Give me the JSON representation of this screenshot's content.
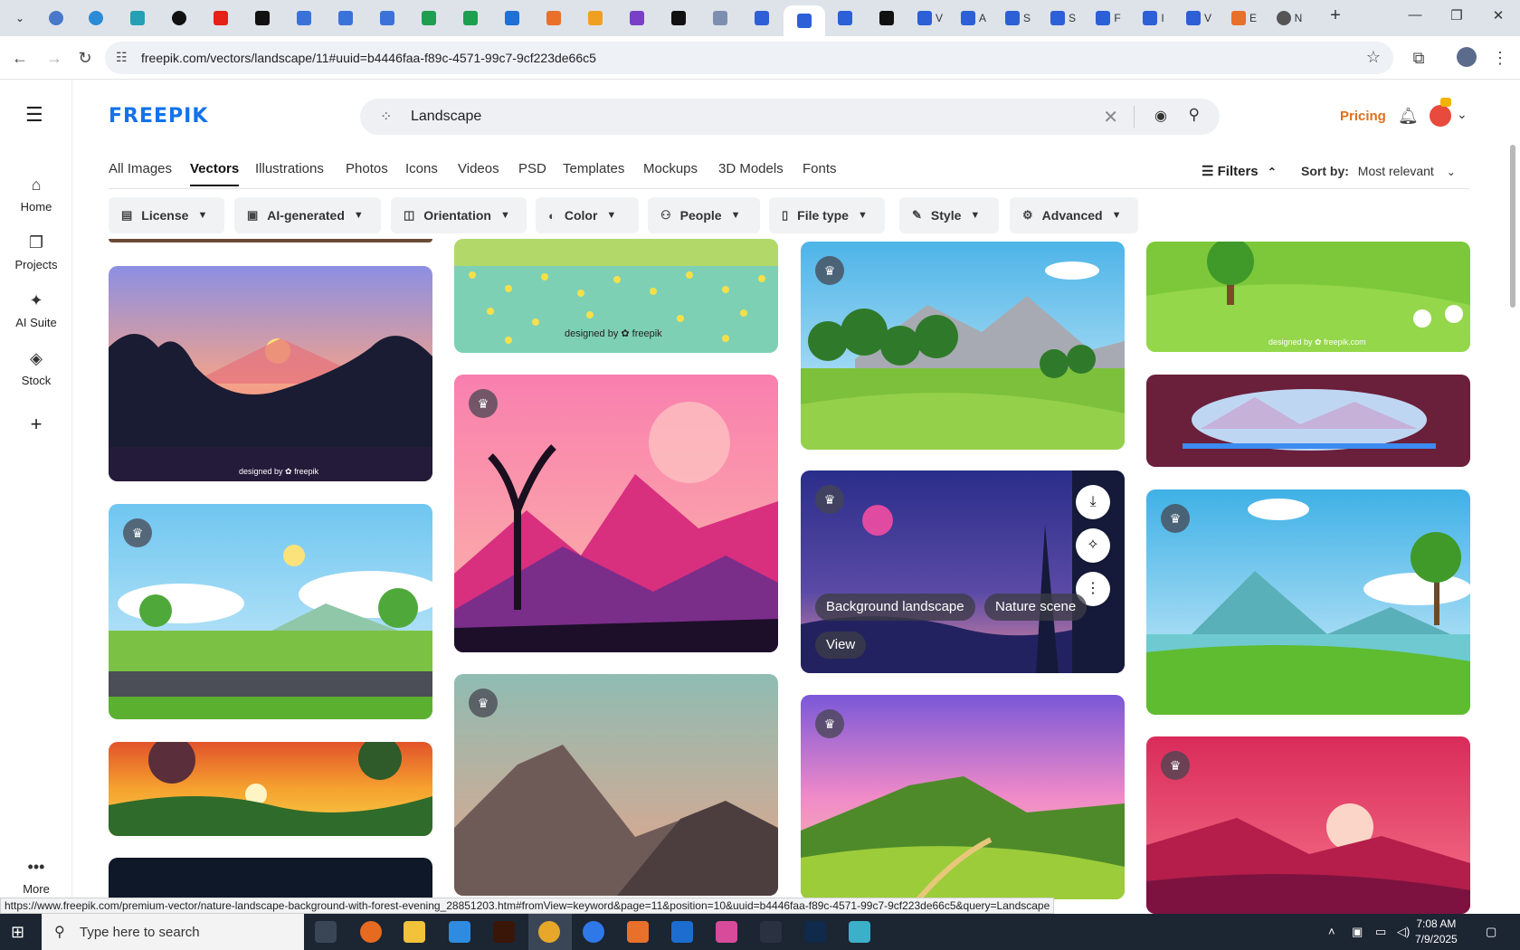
{
  "browser": {
    "active_tab_title": "",
    "tab_titles": [
      "V",
      "A",
      "S",
      "S",
      "F",
      "I",
      "V",
      "E",
      "N"
    ],
    "url": "freepik.com/vectors/landscape/11#uuid=b4446faa-f89c-4571-99c7-9cf223de66c5"
  },
  "rail": {
    "items": [
      {
        "label": "Home",
        "icon": "home-icon"
      },
      {
        "label": "Projects",
        "icon": "projects-icon"
      },
      {
        "label": "AI Suite",
        "icon": "sparkle-icon"
      },
      {
        "label": "Stock",
        "icon": "stock-icon"
      }
    ],
    "more_label": "More"
  },
  "header": {
    "logo": "FREEPIK",
    "search_value": "Landscape",
    "pricing": "Pricing"
  },
  "categories": [
    "All Images",
    "Vectors",
    "Illustrations",
    "Photos",
    "Icons",
    "Videos",
    "PSD",
    "Templates",
    "Mockups",
    "3D Models",
    "Fonts"
  ],
  "active_category": "Vectors",
  "filters_label": "Filters",
  "sort": {
    "label": "Sort by:",
    "value": "Most relevant"
  },
  "chips": [
    "License",
    "AI-generated",
    "Orientation",
    "Color",
    "People",
    "File type",
    "Style",
    "Advanced"
  ],
  "hover_tile": {
    "tags": [
      "Background landscape",
      "Nature scene"
    ],
    "view_label": "View"
  },
  "watermarks": {
    "freepik": "designed by ✿ freepik",
    "freepik_com": "designed by ✿ freepik.com"
  },
  "status_url": "https://www.freepik.com/premium-vector/nature-landscape-background-with-forest-evening_28851203.htm#fromView=keyword&page=11&position=10&uuid=b4446faa-f89c-4571-99c7-9cf223de66c5&query=Landscape",
  "taskbar": {
    "search_placeholder": "Type here to search",
    "time": "7:08 AM",
    "date": "7/9/2025"
  }
}
